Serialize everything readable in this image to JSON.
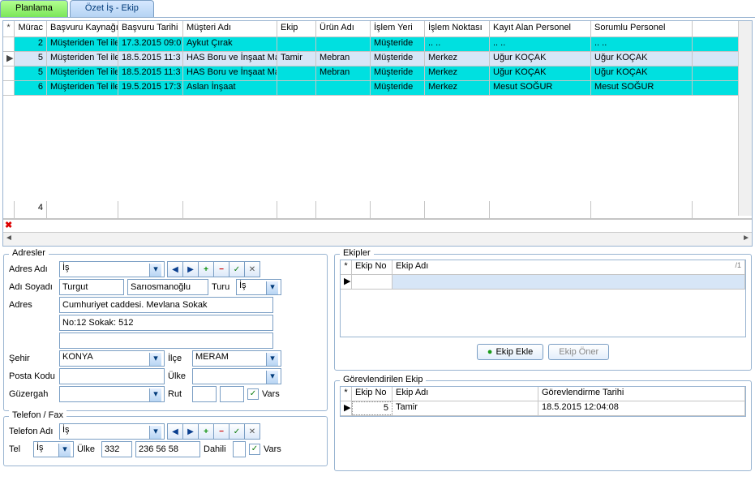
{
  "tabs": {
    "active": "Planlama",
    "inactive": "Özet İş - Ekip"
  },
  "grid": {
    "headers": {
      "indicator": "*",
      "murac": "Mürac",
      "kaynak": "Başvuru Kaynağı",
      "tarih": "Başvuru Tarihi",
      "musteri": "Müşteri Adı",
      "ekip": "Ekip",
      "urun": "Ürün Adı",
      "islem_yeri": "İşlem Yeri",
      "islem_noktasi": "İşlem Noktası",
      "kayit_personel": "Kayıt Alan Personel",
      "sorumlu_personel": "Sorumlu Personel"
    },
    "rows": [
      {
        "ind": "",
        "murac": "2",
        "kaynak": "Müşteriden Tel ile",
        "tarih": "17.3.2015 09:0",
        "musteri": "Aykut Çırak",
        "ekip": "",
        "urun": "",
        "islem_yeri": "Müşteride",
        "islem_noktasi": ".. ..",
        "kayit_personel": ".. ..",
        "sorumlu_personel": ".. ..",
        "cls": "row-teal"
      },
      {
        "ind": "▶",
        "murac": "5",
        "kaynak": "Müşteriden Tel ile",
        "tarih": "18.5.2015 11:3",
        "musteri": "HAS Boru ve İnşaat Malz",
        "ekip": "Tamir",
        "urun": "Mebran",
        "islem_yeri": "Müşteride",
        "islem_noktasi": "Merkez",
        "kayit_personel": "Uğur KOÇAK",
        "sorumlu_personel": "Uğur KOÇAK",
        "cls": "row-sel"
      },
      {
        "ind": "",
        "murac": "5",
        "kaynak": "Müşteriden Tel ile",
        "tarih": "18.5.2015 11:3",
        "musteri": "HAS Boru ve İnşaat Malz",
        "ekip": "",
        "urun": "Mebran",
        "islem_yeri": "Müşteride",
        "islem_noktasi": "Merkez",
        "kayit_personel": "Uğur KOÇAK",
        "sorumlu_personel": "Uğur KOÇAK",
        "cls": "row-teal"
      },
      {
        "ind": "",
        "murac": "6",
        "kaynak": "Müşteriden Tel ile",
        "tarih": "19.5.2015 17:3",
        "musteri": "Aslan İnşaat",
        "ekip": "",
        "urun": "",
        "islem_yeri": "Müşteride",
        "islem_noktasi": "Merkez",
        "kayit_personel": "Mesut SOĞUR",
        "sorumlu_personel": "Mesut SOĞUR",
        "cls": "row-teal"
      }
    ],
    "footer_count": "4"
  },
  "adresler": {
    "title": "Adresler",
    "labels": {
      "adres_adi": "Adres Adı",
      "adi_soyadi": "Adı Soyadı",
      "turu": "Turu",
      "adres": "Adres",
      "sehir": "Şehir",
      "ilce": "İlçe",
      "posta": "Posta Kodu",
      "ulke": "Ülke",
      "guzergah": "Güzergah",
      "rut": "Rut",
      "vars": "Vars"
    },
    "values": {
      "adres_adi": "İş",
      "ad": "Turgut",
      "soyad": "Sarıosmanoğlu",
      "turu": "İş",
      "adres1": "Cumhuriyet caddesi. Mevlana Sokak",
      "adres2": "No:12 Sokak: 512",
      "adres3": "",
      "sehir": "KONYA",
      "ilce": "MERAM",
      "posta": "",
      "ulke": "",
      "guzergah": "",
      "rut1": "",
      "rut2": "",
      "vars_checked": "✓"
    }
  },
  "telefon": {
    "title": "Telefon / Fax",
    "labels": {
      "telefon_adi": "Telefon Adı",
      "tel": "Tel",
      "ulke": "Ülke",
      "dahili": "Dahili",
      "vars": "Vars"
    },
    "values": {
      "telefon_adi": "İş",
      "tel": "İş",
      "ulke": "332",
      "no": "236 56 58",
      "dahili": "",
      "vars_checked": "✓"
    }
  },
  "ekipler": {
    "title": "Ekipler",
    "headers": {
      "ind": "*",
      "no": "Ekip No",
      "adi": "Ekip Adı",
      "sort": "/1"
    },
    "buttons": {
      "ekle": "Ekip Ekle",
      "oner": "Ekip Öner"
    }
  },
  "gorev": {
    "title": "Görevlendirilen Ekip",
    "headers": {
      "ind": "*",
      "no": "Ekip No",
      "adi": "Ekip Adı",
      "tarih": "Görevlendirme Tarihi"
    },
    "row": {
      "ind": "▶",
      "no": "5",
      "adi": "Tamir",
      "tarih": "18.5.2015 12:04:08"
    }
  }
}
